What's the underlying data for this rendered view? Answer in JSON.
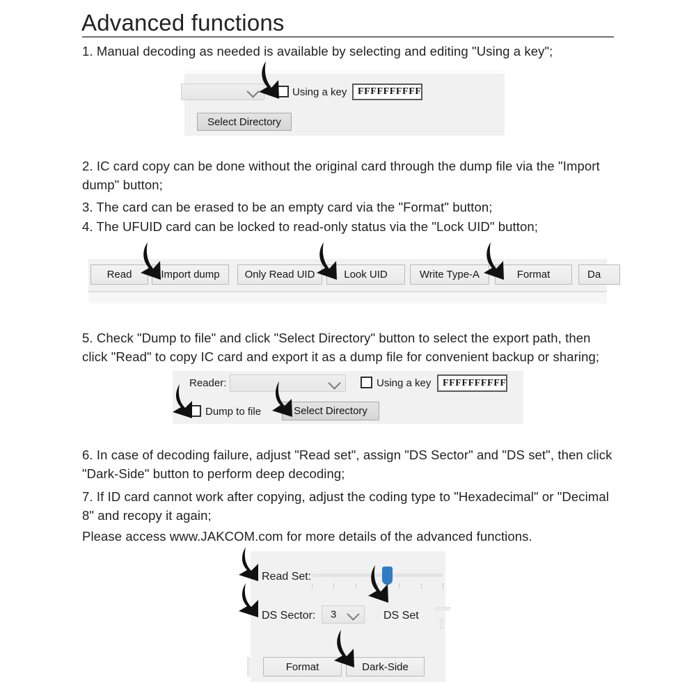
{
  "document": {
    "title": "Advanced functions",
    "paragraphs": [
      "1. Manual decoding as needed is available by selecting and editing \"Using a key\";",
      "2. IC card copy can be done without the original card through the dump file via the \"Import dump\" button;",
      "3. The card can be erased to be an empty card via the \"Format\" button;",
      "4. The UFUID card can be locked to read-only status via the \"Lock UID\" button;",
      "5. Check \"Dump to file\" and click \"Select Directory\" button to select the export path, then click \"Read\" to copy IC card and export it as a dump file for convenient backup or sharing;",
      "6. In case of decoding failure, adjust \"Read set\", assign \"DS Sector\" and \"DS set\", then click \"Dark-Side\" button to perform deep decoding;",
      "7. If ID card cannot work after copying, adjust the coding type to \"Hexadecimal\" or \"Decimal 8\" and recopy it again;",
      "Please access www.JAKCOM.com for more details of the advanced functions."
    ]
  },
  "panel_one": {
    "reader_combo_value": "",
    "using_key_label": "Using a key",
    "using_key_checked": false,
    "key_value": "FFFFFFFFFFFF",
    "select_directory_label": "Select Directory"
  },
  "toolbar": {
    "buttons": [
      "Read",
      "Import dump",
      "Only Read UID",
      "Look UID",
      "Write Type-A",
      "Format",
      "Da"
    ]
  },
  "panel_two": {
    "reader_label": "Reader:",
    "reader_combo_value": "",
    "using_key_label": "Using a key",
    "using_key_checked": false,
    "key_value": "FFFFFFFFFFFF",
    "dump_to_file_label": "Dump to file",
    "dump_to_file_checked": false,
    "select_directory_label": "Select Directory"
  },
  "panel_three": {
    "read_set_label": "Read Set:",
    "read_set_value": 55,
    "ds_sector_label": "DS Sector:",
    "ds_sector_value": "3",
    "ds_set_label": "DS Set",
    "format_label": "Format",
    "dark_side_label": "Dark-Side"
  },
  "colors": {
    "slider_thumb": "#2e7cc4",
    "rule": "#6f6f6f",
    "panel_bg": "#f1f1f1"
  }
}
